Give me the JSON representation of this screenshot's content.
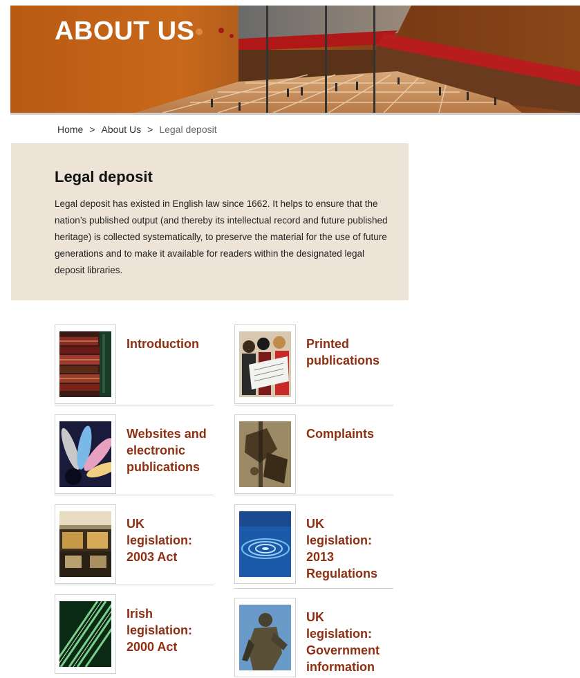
{
  "banner": {
    "title": "ABOUT US"
  },
  "breadcrumb": {
    "items": [
      "Home",
      "About Us"
    ],
    "separator": ">",
    "current": "Legal deposit"
  },
  "intro": {
    "heading": "Legal deposit",
    "body": "Legal deposit has existed in English law since 1662. It helps to ensure that the nation’s published output (and thereby its intellectual record and future published heritage) is collected systematically, to preserve the material for the use of future generations and to make it available for readers within the designated legal deposit libraries."
  },
  "tiles": [
    {
      "label": "Introduction",
      "image": "old-books-image"
    },
    {
      "label": "Printed publications",
      "image": "readers-with-newspaper-image"
    },
    {
      "label": "Websites and electronic publications",
      "image": "colorful-discs-image"
    },
    {
      "label": "Complaints",
      "image": "sculpture-detail-image"
    },
    {
      "label": "UK legislation: 2003 Act",
      "image": "library-interior-image"
    },
    {
      "label": "UK legislation: 2013 Regulations",
      "image": "water-ripple-image"
    },
    {
      "label": "Irish legislation: 2000 Act",
      "image": "green-stripes-image"
    },
    {
      "label": "UK legislation: Government information",
      "image": "statue-image"
    }
  ],
  "colors": {
    "link_accent": "#8e2f12",
    "intro_background": "#ede3d6",
    "banner_orange": "#c8681a"
  }
}
